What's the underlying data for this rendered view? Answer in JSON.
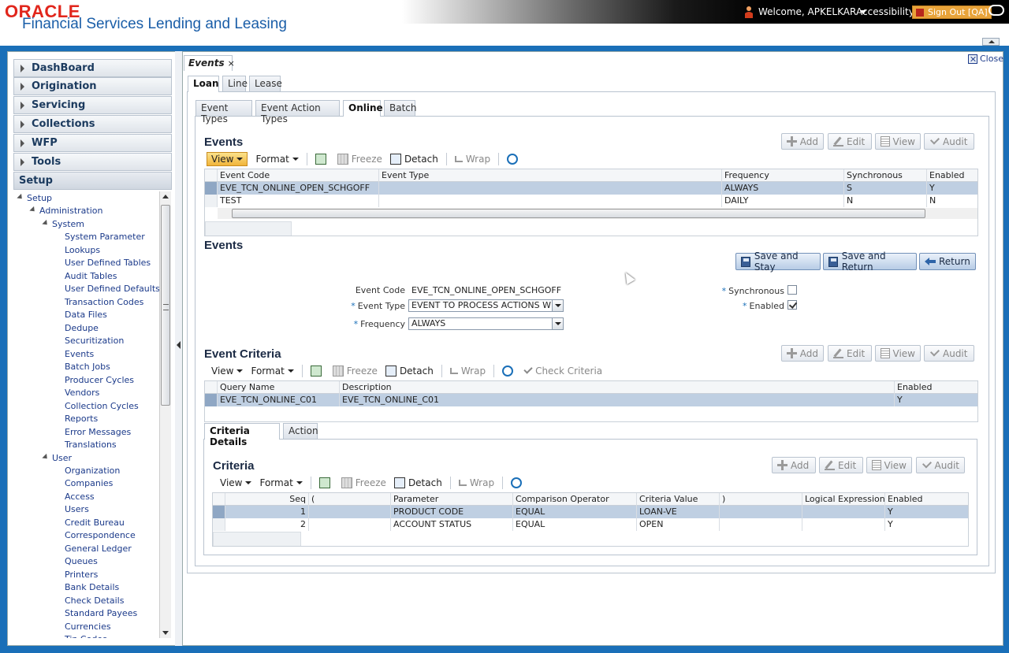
{
  "header": {
    "brand": "ORACLE",
    "product": "Financial Services Lending and Leasing",
    "welcome": "Welcome, APKELKAR",
    "accessibility": "Accessibility",
    "sign_out": "Sign Out [QA]"
  },
  "sidebar": {
    "accordion": [
      "DashBoard",
      "Origination",
      "Servicing",
      "Collections",
      "WFP",
      "Tools",
      "Setup"
    ],
    "tree": {
      "root": "Setup",
      "administration": "Administration",
      "system": "System",
      "system_items": [
        "System Parameter",
        "Lookups",
        "User Defined Tables",
        "Audit Tables",
        "User Defined Defaults",
        "Transaction Codes",
        "Data Files",
        "Dedupe",
        "Securitization",
        "Events",
        "Batch Jobs",
        "Producer Cycles",
        "Vendors",
        "Collection Cycles",
        "Reports",
        "Error Messages",
        "Translations"
      ],
      "user": "User",
      "user_items": [
        "Organization",
        "Companies",
        "Access",
        "Users",
        "Credit Bureau",
        "Correspondence",
        "General Ledger",
        "Queues",
        "Printers",
        "Bank Details",
        "Check Details",
        "Standard Payees",
        "Currencies",
        "Tin Codes"
      ]
    }
  },
  "main": {
    "doc_tab": "Events",
    "doc_tab_close": "×",
    "close": "Close",
    "top_tabs": [
      "Loan",
      "Line",
      "Lease"
    ],
    "sub_tabs": [
      "Event Types",
      "Event Action Types",
      "Online",
      "Batch"
    ],
    "actions": {
      "add": "Add",
      "edit": "Edit",
      "view": "View",
      "audit": "Audit"
    },
    "toolbar": {
      "view": "View",
      "format": "Format",
      "freeze": "Freeze",
      "detach": "Detach",
      "wrap": "Wrap",
      "check_criteria": "Check Criteria"
    },
    "events_table": {
      "title": "Events",
      "columns": [
        "Event Code",
        "Event Type",
        "Frequency",
        "Synchronous",
        "Enabled"
      ],
      "rows": [
        [
          "EVE_TCN_ONLINE_OPEN_SCHGOFF",
          "",
          "ALWAYS",
          "S",
          "Y"
        ],
        [
          "TEST",
          "",
          "DAILY",
          "N",
          "N"
        ]
      ]
    },
    "events_form": {
      "title": "Events",
      "save_stay": "Save and Stay",
      "save_return": "Save and Return",
      "return": "Return",
      "event_code_label": "Event Code",
      "event_code_value": "EVE_TCN_ONLINE_OPEN_SCHGOFF",
      "event_type_label": "Event Type",
      "event_type_value": "EVENT TO PROCESS ACTIONS WHEN",
      "frequency_label": "Frequency",
      "frequency_value": "ALWAYS",
      "synchronous_label": "Synchronous",
      "synchronous_checked": false,
      "enabled_label": "Enabled",
      "enabled_checked": true,
      "required_mark": "*"
    },
    "criteria_table": {
      "title": "Event Criteria",
      "columns": [
        "Query Name",
        "Description",
        "Enabled"
      ],
      "rows": [
        [
          "EVE_TCN_ONLINE_C01",
          "EVE_TCN_ONLINE_C01",
          "Y"
        ]
      ]
    },
    "detail_tabs": [
      "Criteria Details",
      "Action"
    ],
    "criteria": {
      "title": "Criteria",
      "columns": [
        "Seq",
        "(",
        "Parameter",
        "Comparison Operator",
        "Criteria Value",
        ")",
        "Logical Expression",
        "Enabled"
      ],
      "rows": [
        [
          "1",
          "",
          "PRODUCT CODE",
          "EQUAL",
          "LOAN-VE",
          "",
          "",
          "Y"
        ],
        [
          "2",
          "",
          "ACCOUNT STATUS",
          "EQUAL",
          "OPEN",
          "",
          "",
          "Y"
        ]
      ]
    }
  }
}
